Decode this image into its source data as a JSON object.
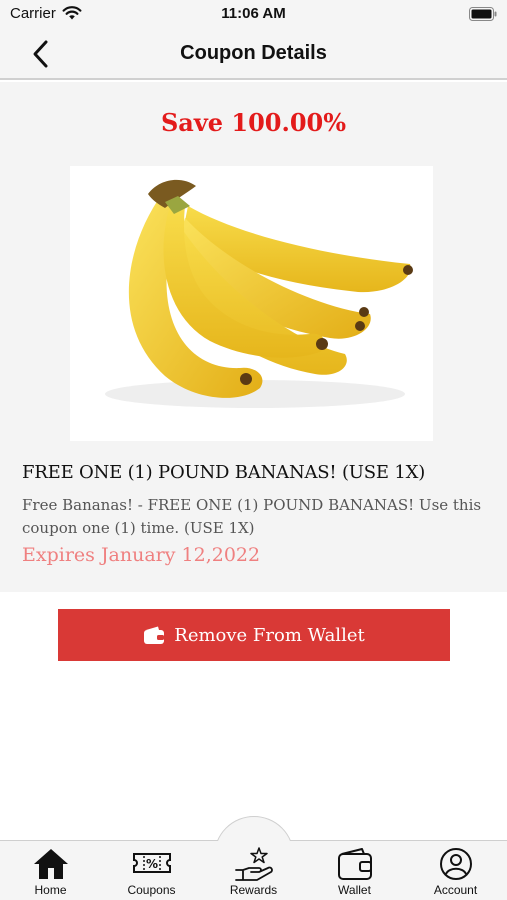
{
  "status_bar": {
    "carrier": "Carrier",
    "time": "11:06 AM"
  },
  "nav": {
    "title": "Coupon Details"
  },
  "coupon": {
    "save_text": "Save 100.00%",
    "product_image_icon": "bananas-photo",
    "title": "FREE ONE (1) POUND BANANAS! (USE 1X)",
    "description": "Free Bananas! - FREE ONE (1) POUND BANANAS! Use this coupon one (1) time. (USE 1X)",
    "expiry": "Expires January 12,2022"
  },
  "actions": {
    "remove_label": "Remove From Wallet",
    "remove_icon": "wallet-icon"
  },
  "tabs": [
    {
      "label": "Home",
      "icon": "home-icon"
    },
    {
      "label": "Coupons",
      "icon": "coupon-icon"
    },
    {
      "label": "Rewards",
      "icon": "rewards-icon"
    },
    {
      "label": "Wallet",
      "icon": "wallet-icon"
    },
    {
      "label": "Account",
      "icon": "account-icon"
    }
  ],
  "colors": {
    "accent": "#d93936",
    "save_text": "#e31b1b",
    "expiry": "#ef8080",
    "background": "#f4f4f4"
  }
}
